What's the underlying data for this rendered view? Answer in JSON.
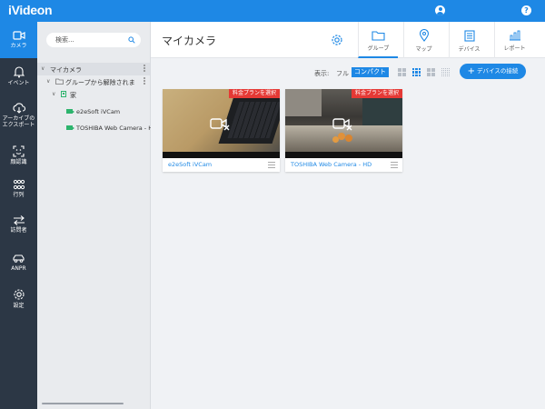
{
  "app": {
    "logo": "iVideon"
  },
  "nav": {
    "items": [
      {
        "label": "カメラ"
      },
      {
        "label": "イベント"
      },
      {
        "label": "アーカイブの\nエクスポート"
      },
      {
        "label": "顔認識"
      },
      {
        "label": "行列"
      },
      {
        "label": "訪問者"
      },
      {
        "label": "ANPR"
      },
      {
        "label": "設定"
      }
    ]
  },
  "tree": {
    "search_placeholder": "検索...",
    "root": "マイカメラ",
    "group": "グループから解除されま",
    "location": "家",
    "cameras": [
      "e2eSoft iVCam",
      "TOSHIBA Web Camera - HD"
    ]
  },
  "main": {
    "title": "マイカメラ",
    "tabs": [
      {
        "label": "グループ",
        "icon": "folder-icon"
      },
      {
        "label": "マップ",
        "icon": "map-pin-icon"
      },
      {
        "label": "デバイス",
        "icon": "device-icon"
      },
      {
        "label": "レポート",
        "icon": "report-icon"
      }
    ],
    "display_label": "表示:",
    "view_full": "フル",
    "view_compact": "コンパクト",
    "add_device": "デバイスの接続",
    "accent": "#1e88e5"
  },
  "cards": [
    {
      "name": "e2eSoft iVCam",
      "badge": "料金プランを選択"
    },
    {
      "name": "TOSHIBA Web Camera - HD",
      "badge": "料金プランを選択"
    }
  ]
}
